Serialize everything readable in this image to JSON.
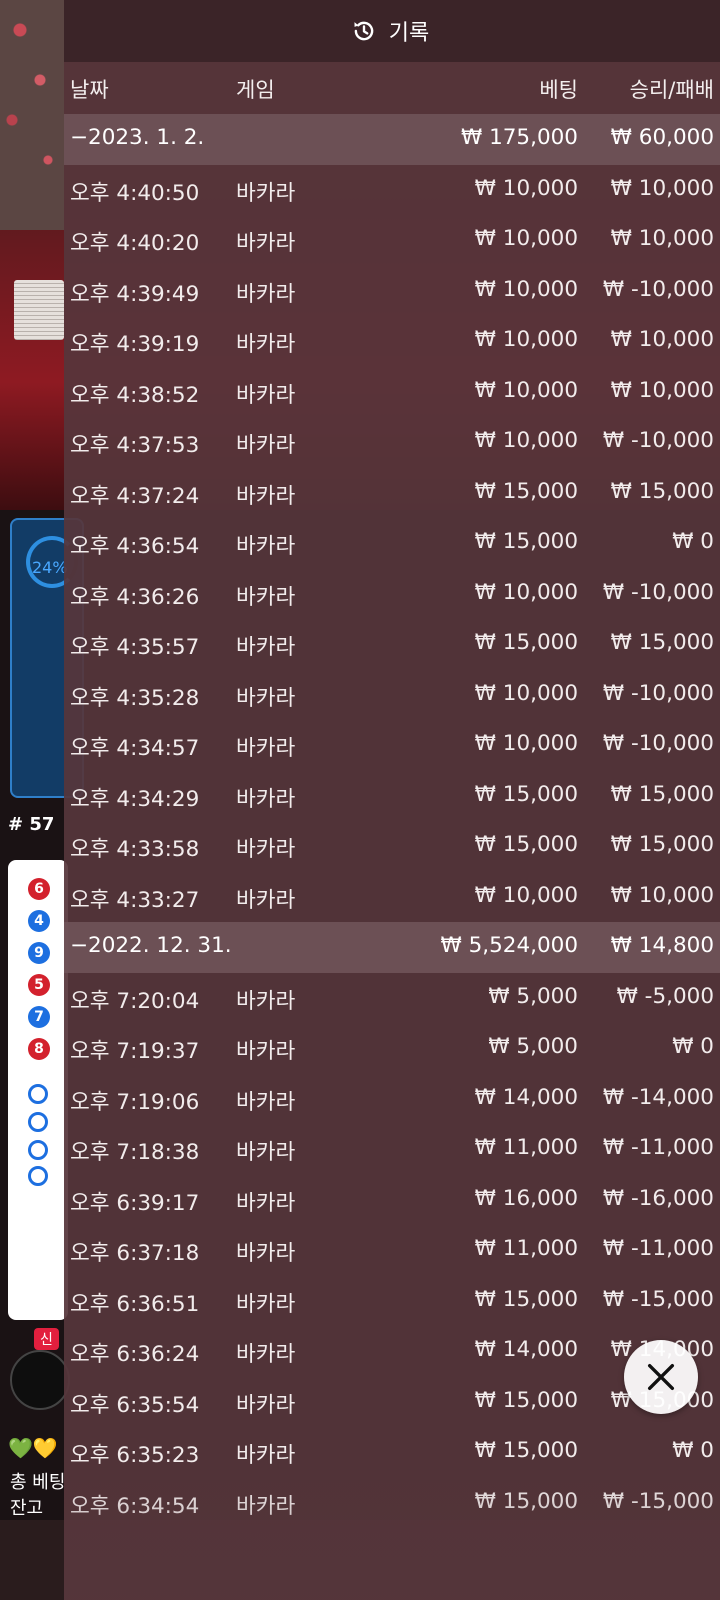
{
  "header": {
    "title": "기록",
    "icon": "history-icon"
  },
  "columns": {
    "date": "날짜",
    "game": "게임",
    "bet": "베팅",
    "result": "승리/패배"
  },
  "rows": [
    {
      "type": "group",
      "date": "−2023. 1. 2.",
      "bet": "₩ 175,000",
      "result": "₩ 60,000"
    },
    {
      "type": "item",
      "time": "오후 4:40:50",
      "game": "바카라",
      "bet": "₩ 10,000",
      "result": "₩ 10,000"
    },
    {
      "type": "item",
      "time": "오후 4:40:20",
      "game": "바카라",
      "bet": "₩ 10,000",
      "result": "₩ 10,000"
    },
    {
      "type": "item",
      "time": "오후 4:39:49",
      "game": "바카라",
      "bet": "₩ 10,000",
      "result": "₩ -10,000"
    },
    {
      "type": "item",
      "time": "오후 4:39:19",
      "game": "바카라",
      "bet": "₩ 10,000",
      "result": "₩ 10,000"
    },
    {
      "type": "item",
      "time": "오후 4:38:52",
      "game": "바카라",
      "bet": "₩ 10,000",
      "result": "₩ 10,000"
    },
    {
      "type": "item",
      "time": "오후 4:37:53",
      "game": "바카라",
      "bet": "₩ 10,000",
      "result": "₩ -10,000"
    },
    {
      "type": "item",
      "time": "오후 4:37:24",
      "game": "바카라",
      "bet": "₩ 15,000",
      "result": "₩ 15,000"
    },
    {
      "type": "item",
      "time": "오후 4:36:54",
      "game": "바카라",
      "bet": "₩ 15,000",
      "result": "₩ 0"
    },
    {
      "type": "item",
      "time": "오후 4:36:26",
      "game": "바카라",
      "bet": "₩ 10,000",
      "result": "₩ -10,000"
    },
    {
      "type": "item",
      "time": "오후 4:35:57",
      "game": "바카라",
      "bet": "₩ 15,000",
      "result": "₩ 15,000"
    },
    {
      "type": "item",
      "time": "오후 4:35:28",
      "game": "바카라",
      "bet": "₩ 10,000",
      "result": "₩ -10,000"
    },
    {
      "type": "item",
      "time": "오후 4:34:57",
      "game": "바카라",
      "bet": "₩ 10,000",
      "result": "₩ -10,000"
    },
    {
      "type": "item",
      "time": "오후 4:34:29",
      "game": "바카라",
      "bet": "₩ 15,000",
      "result": "₩ 15,000"
    },
    {
      "type": "item",
      "time": "오후 4:33:58",
      "game": "바카라",
      "bet": "₩ 15,000",
      "result": "₩ 15,000"
    },
    {
      "type": "item",
      "time": "오후 4:33:27",
      "game": "바카라",
      "bet": "₩ 10,000",
      "result": "₩ 10,000"
    },
    {
      "type": "group",
      "date": "−2022. 12. 31.",
      "bet": "₩ 5,524,000",
      "result": "₩ 14,800"
    },
    {
      "type": "item",
      "time": "오후 7:20:04",
      "game": "바카라",
      "bet": "₩ 5,000",
      "result": "₩ -5,000"
    },
    {
      "type": "item",
      "time": "오후 7:19:37",
      "game": "바카라",
      "bet": "₩ 5,000",
      "result": "₩ 0"
    },
    {
      "type": "item",
      "time": "오후 7:19:06",
      "game": "바카라",
      "bet": "₩ 14,000",
      "result": "₩ -14,000"
    },
    {
      "type": "item",
      "time": "오후 7:18:38",
      "game": "바카라",
      "bet": "₩ 11,000",
      "result": "₩ -11,000"
    },
    {
      "type": "item",
      "time": "오후 6:39:17",
      "game": "바카라",
      "bet": "₩ 16,000",
      "result": "₩ -16,000"
    },
    {
      "type": "item",
      "time": "오후 6:37:18",
      "game": "바카라",
      "bet": "₩ 11,000",
      "result": "₩ -11,000"
    },
    {
      "type": "item",
      "time": "오후 6:36:51",
      "game": "바카라",
      "bet": "₩ 15,000",
      "result": "₩ -15,000"
    },
    {
      "type": "item",
      "time": "오후 6:36:24",
      "game": "바카라",
      "bet": "₩ 14,000",
      "result": "₩ 14,000"
    },
    {
      "type": "item",
      "time": "오후 6:35:54",
      "game": "바카라",
      "bet": "₩ 15,000",
      "result": "₩ 15,000"
    },
    {
      "type": "item",
      "time": "오후 6:35:23",
      "game": "바카라",
      "bet": "₩ 15,000",
      "result": "₩ 0"
    },
    {
      "type": "item",
      "time": "오후 6:34:54",
      "game": "바카라",
      "bet": "₩ 15,000",
      "result": "₩ -15,000"
    }
  ],
  "background": {
    "chip_percent": "24%",
    "round_label": "# 57",
    "new_badge": "신",
    "total_bet_label": "총 베팅",
    "balance_label": "잔고"
  },
  "close_button": {
    "icon": "close-icon"
  },
  "colors": {
    "panel": "#56363b",
    "group_row": "#705459",
    "header": "#3a2328",
    "text": "#f2ecec"
  }
}
